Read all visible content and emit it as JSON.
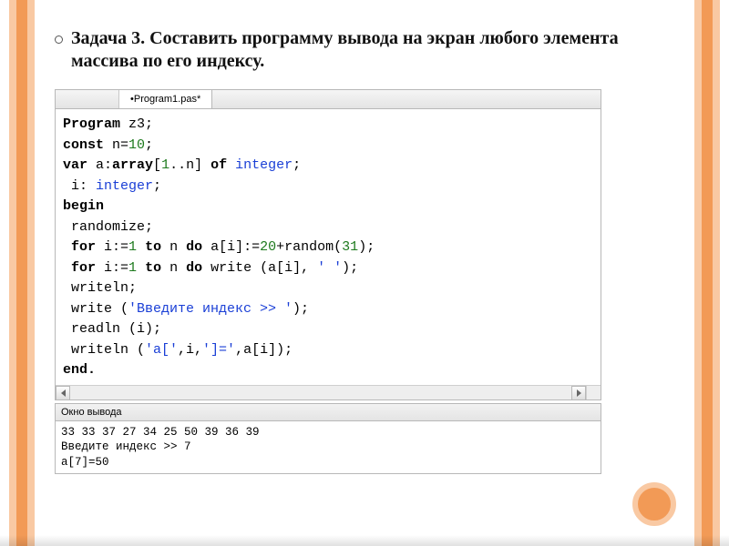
{
  "task": "Задача 3. Составить программу вывода на экран любого элемента массива по его индексу.",
  "tab": "•Program1.pas*",
  "code": {
    "l1a": "Program",
    "l1b": " z3;",
    "l2a": "const",
    "l2b": " n=",
    "l2c": "10",
    "l2d": ";",
    "l3a": "var",
    "l3b": " a:",
    "l3c": "array",
    "l3d": "[",
    "l3e": "1",
    "l3f": "..n] ",
    "l3g": "of",
    "l3h": " ",
    "l3i": "integer",
    "l3j": ";",
    "l4a": " i: ",
    "l4b": "integer",
    "l4c": ";",
    "l5": "begin",
    "l6": " randomize;",
    "l7a": " ",
    "l7b": "for",
    "l7c": " i:=",
    "l7d": "1",
    "l7e": " ",
    "l7f": "to",
    "l7g": " n ",
    "l7h": "do",
    "l7i": " a[i]:=",
    "l7j": "20",
    "l7k": "+random(",
    "l7l": "31",
    "l7m": ");",
    "l8a": " ",
    "l8b": "for",
    "l8c": " i:=",
    "l8d": "1",
    "l8e": " ",
    "l8f": "to",
    "l8g": " n ",
    "l8h": "do",
    "l8i": " write (a[i], ",
    "l8j": "' '",
    "l8k": ");",
    "l9": " writeln;",
    "l10a": " write (",
    "l10b": "'Введите индекс >> '",
    "l10c": ");",
    "l11": " readln (i);",
    "l12a": " writeln (",
    "l12b": "'a['",
    "l12c": ",i,",
    "l12d": "']='",
    "l12e": ",a[i]);",
    "l13": "end."
  },
  "output_title": "Окно вывода",
  "output": {
    "line1": "33 33 37 27 34 25 50 39 36 39",
    "line2": "Введите индекс >> 7",
    "line3": "a[7]=50"
  }
}
